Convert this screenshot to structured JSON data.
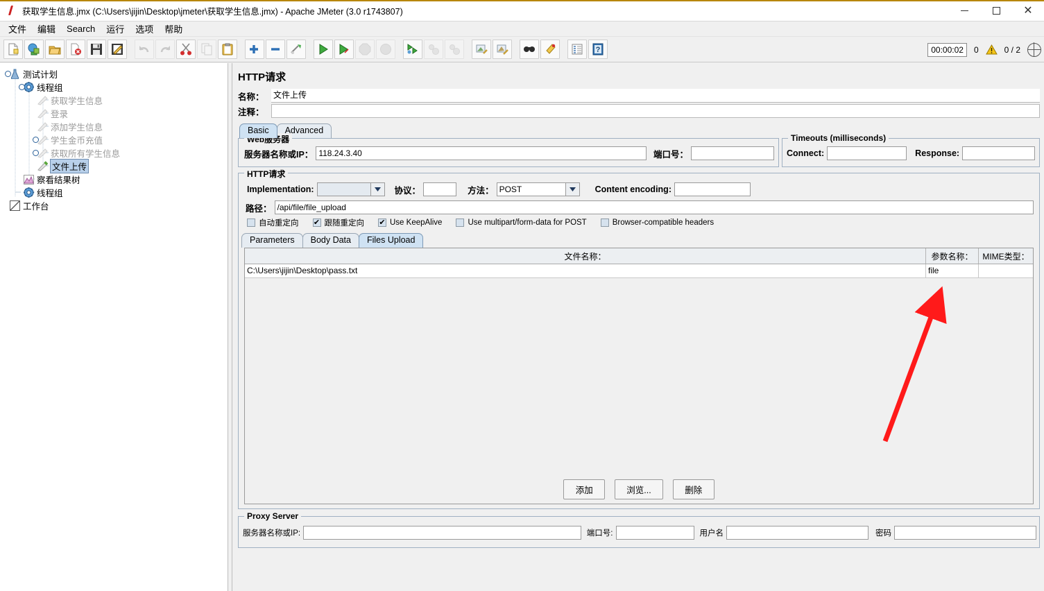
{
  "window": {
    "title": "获取学生信息.jmx (C:\\Users\\jijin\\Desktop\\jmeter\\获取学生信息.jmx) - Apache JMeter (3.0 r1743807)",
    "app_icon": "jmeter-bolt-icon",
    "minimize": "—",
    "maximize": "□",
    "close": "✕"
  },
  "menu": {
    "items": [
      {
        "label": "文件"
      },
      {
        "label": "编辑"
      },
      {
        "label": "Search"
      },
      {
        "label": "运行"
      },
      {
        "label": "选项"
      },
      {
        "label": "帮助"
      }
    ]
  },
  "toolbar": {
    "buttons": [
      {
        "name": "new-icon"
      },
      {
        "name": "templates-icon"
      },
      {
        "name": "open-icon"
      },
      {
        "name": "close-icon"
      },
      {
        "name": "save-icon"
      },
      {
        "name": "save-as-icon"
      },
      {
        "name": "undo-icon"
      },
      {
        "name": "redo-icon"
      },
      {
        "name": "cut-icon"
      },
      {
        "name": "copy-icon"
      },
      {
        "name": "paste-icon"
      },
      {
        "name": "expand-icon"
      },
      {
        "name": "collapse-icon"
      },
      {
        "name": "toggle-icon"
      },
      {
        "name": "start-icon"
      },
      {
        "name": "start-no-pauses-icon"
      },
      {
        "name": "stop-icon"
      },
      {
        "name": "shutdown-icon"
      },
      {
        "name": "start-remote-all-icon"
      },
      {
        "name": "stop-remote-all-icon"
      },
      {
        "name": "shutdown-remote-all-icon"
      },
      {
        "name": "clear-icon"
      },
      {
        "name": "clear-all-icon"
      },
      {
        "name": "search-icon"
      },
      {
        "name": "search-reset-icon"
      },
      {
        "name": "function-helper-icon"
      },
      {
        "name": "help-icon"
      }
    ],
    "timer": "00:00:02",
    "warn_count": "0",
    "warn_icon": "warning-triangle-icon",
    "thread_count": "0 / 2",
    "globe_icon": "globe-icon"
  },
  "tree": {
    "nodes": [
      {
        "label": "测试计划",
        "icon": "test-plan-icon",
        "depth": 0,
        "state": "normal",
        "handle": true
      },
      {
        "label": "线程组",
        "icon": "thread-group-icon",
        "depth": 1,
        "state": "normal",
        "handle": true
      },
      {
        "label": "获取学生信息",
        "icon": "http-request-icon",
        "depth": 2,
        "state": "disabled",
        "handle": false
      },
      {
        "label": "登录",
        "icon": "http-request-icon",
        "depth": 2,
        "state": "disabled",
        "handle": false
      },
      {
        "label": "添加学生信息",
        "icon": "http-request-icon",
        "depth": 2,
        "state": "disabled",
        "handle": false
      },
      {
        "label": "学生金币充值",
        "icon": "http-request-icon",
        "depth": 2,
        "state": "disabled",
        "handle": true
      },
      {
        "label": "获取所有学生信息",
        "icon": "http-request-icon",
        "depth": 2,
        "state": "disabled",
        "handle": true
      },
      {
        "label": "文件上传",
        "icon": "http-request-icon",
        "depth": 2,
        "state": "selected",
        "handle": false
      },
      {
        "label": "察看结果树",
        "icon": "view-results-tree-icon",
        "depth": 1,
        "state": "normal",
        "handle": false
      },
      {
        "label": "线程组",
        "icon": "thread-group-icon",
        "depth": 1,
        "state": "normal",
        "handle": false
      },
      {
        "label": "工作台",
        "icon": "workbench-icon",
        "depth": 0,
        "state": "normal",
        "handle": false
      }
    ]
  },
  "pane": {
    "title": "HTTP请求",
    "name_label": "名称：",
    "name_value": "文件上传",
    "comment_label": "注释：",
    "comment_value": "",
    "tabs": [
      {
        "label": "Basic",
        "selected": true
      },
      {
        "label": "Advanced",
        "selected": false
      }
    ]
  },
  "webserver": {
    "group_title": "Web服务器",
    "host_label": "服务器名称或IP：",
    "host_value": "118.24.3.40",
    "port_label": "端口号：",
    "port_value": ""
  },
  "timeouts": {
    "group_title": "Timeouts (milliseconds)",
    "connect_label": "Connect:",
    "connect_value": "",
    "response_label": "Response:",
    "response_value": ""
  },
  "httprequest": {
    "group_title": "HTTP请求",
    "implementation_label": "Implementation:",
    "implementation_value": "",
    "protocol_label": "协议：",
    "protocol_value": "",
    "method_label": "方法：",
    "method_value": "POST",
    "content_encoding_label": "Content encoding:",
    "content_encoding_value": "",
    "path_label": "路径：",
    "path_value": "/api/file/file_upload",
    "checkboxes": [
      {
        "label": "自动重定向",
        "checked": false
      },
      {
        "label": "跟随重定向",
        "checked": true
      },
      {
        "label": "Use KeepAlive",
        "checked": true
      },
      {
        "label": "Use multipart/form-data for POST",
        "checked": false
      },
      {
        "label": "Browser-compatible headers",
        "checked": false
      }
    ]
  },
  "datatabs": [
    {
      "label": "Parameters",
      "selected": false
    },
    {
      "label": "Body Data",
      "selected": false
    },
    {
      "label": "Files Upload",
      "selected": true
    }
  ],
  "filetable": {
    "columns": [
      "文件名称：",
      "参数名称：",
      "MIME类型："
    ],
    "rows": [
      [
        "C:\\Users\\jijin\\Desktop\\pass.txt",
        "file",
        ""
      ]
    ],
    "buttons": [
      {
        "label": "添加",
        "name": "add-file-button"
      },
      {
        "label": "浏览...",
        "name": "browse-file-button"
      },
      {
        "label": "删除",
        "name": "delete-file-button"
      }
    ]
  },
  "proxy": {
    "group_title": "Proxy Server",
    "host_label": "服务器名称或IP:",
    "host_value": "",
    "port_label": "端口号:",
    "port_value": "",
    "username_label": "用户名",
    "username_value": "",
    "password_label": "密码",
    "password_value": ""
  },
  "annotation": {
    "arrow_color": "#ff1a1a",
    "name": "red-pointer-arrow"
  }
}
